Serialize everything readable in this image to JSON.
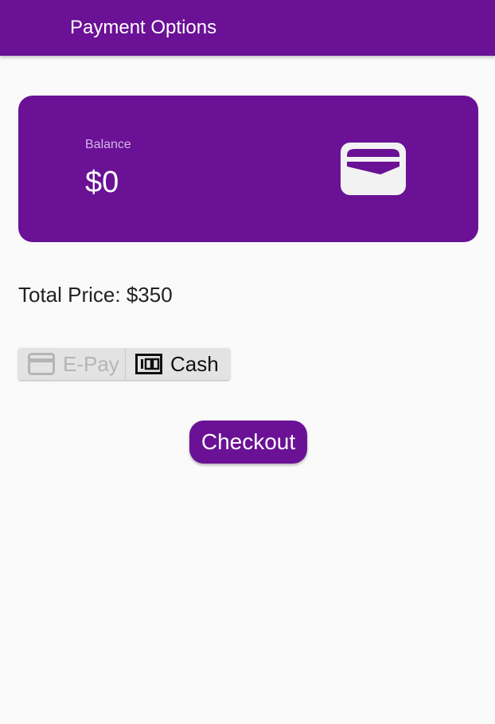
{
  "app_bar": {
    "title": "Payment Options"
  },
  "balance_card": {
    "label": "Balance",
    "value": "$0",
    "icon": "wallet-icon"
  },
  "total_price": "Total Price: $350",
  "payment_toggle": {
    "options": [
      {
        "label": "E-Pay",
        "icon": "credit-card-icon",
        "selected": false
      },
      {
        "label": "Cash",
        "icon": "cash-icon",
        "selected": true
      }
    ]
  },
  "checkout": {
    "label": "Checkout"
  },
  "colors": {
    "primary": "#6a1196",
    "background": "#fafafa",
    "toggle_background": "#e3e3e3",
    "disabled_text": "#b5b5b5"
  }
}
